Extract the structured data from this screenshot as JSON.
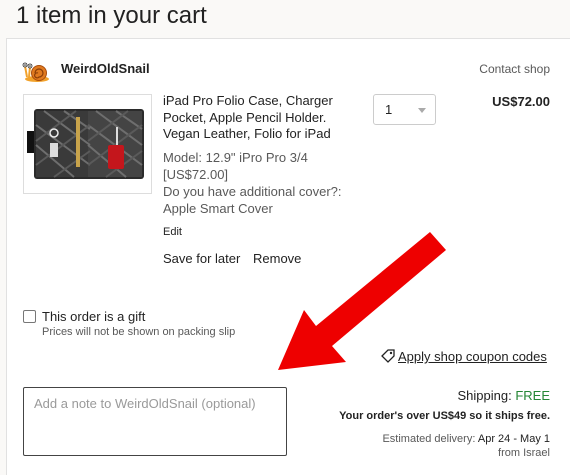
{
  "page": {
    "title": "1 item in your cart"
  },
  "shop": {
    "name": "WeirdOldSnail",
    "contact_label": "Contact shop"
  },
  "item": {
    "title": "iPad Pro Folio Case, Charger Pocket, Apple Pencil Holder. Vegan Leather, Folio for iPad",
    "variation_line1": "Model: 12.9\" iPro Pro 3/4",
    "variation_line2": "[US$72.00]",
    "variation_line3": "Do you have additional cover?:",
    "variation_line4": "Apple Smart Cover",
    "edit_label": "Edit",
    "save_label": "Save for later",
    "remove_label": "Remove",
    "quantity": "1",
    "price": "US$72.00"
  },
  "gift": {
    "label": "This order is a gift",
    "subtext": "Prices will not be shown on packing slip"
  },
  "coupon": {
    "label": "Apply shop coupon codes"
  },
  "note": {
    "placeholder": "Add a note to WeirdOldSnail (optional)"
  },
  "shipping": {
    "label": "Shipping:",
    "value": "FREE",
    "note": "Your order's over US$49 so it ships free.",
    "delivery_label": "Estimated delivery:",
    "delivery_dates": "Apr 24 - May 1",
    "origin": "from Israel"
  },
  "colors": {
    "free": "#258635",
    "arrow": "#ee0000"
  }
}
